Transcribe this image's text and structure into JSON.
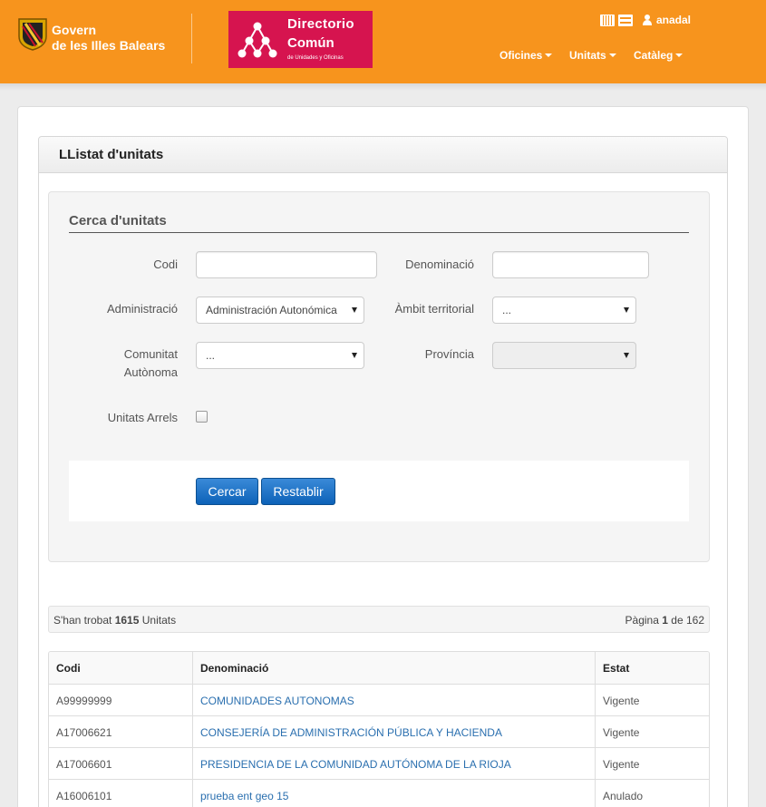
{
  "header": {
    "govern_line1": "Govern",
    "govern_line2": "de les Illes Balears",
    "directory_logo": {
      "line1": "Directorio",
      "line2": "Común",
      "line3": "de Unidades y Oficinas"
    },
    "username": "anadal",
    "nav": [
      "Oficines",
      "Unitats",
      "Catàleg"
    ],
    "colors": {
      "accent": "#f7941d",
      "brand_red": "#d6144f"
    }
  },
  "page": {
    "title": "LListat d'unitats"
  },
  "search": {
    "legend": "Cerca d'unitats",
    "labels": {
      "codi": "Codi",
      "denominacio": "Denominació",
      "administracio": "Administració",
      "ambit": "Àmbit territorial",
      "comunitat_line1": "Comunitat",
      "comunitat_line2": "Autònoma",
      "provincia": "Província",
      "arrels": "Unitats Arrels"
    },
    "values": {
      "codi": "",
      "denominacio": "",
      "administracio": "Administración Autonómica",
      "ambit": "...",
      "comunitat": "...",
      "provincia": ""
    },
    "buttons": {
      "cercar": "Cercar",
      "restablir": "Restablir"
    }
  },
  "results": {
    "found_prefix": "S'han trobat",
    "found_count": "1615",
    "found_suffix": "Unitats",
    "page_label": "Pàgina",
    "page_current": "1",
    "page_of": "de",
    "page_total": "162",
    "columns": [
      "Codi",
      "Denominació",
      "Estat"
    ],
    "rows": [
      {
        "codi": "A99999999",
        "denominacio": "COMUNIDADES AUTONOMAS",
        "estat": "Vigente"
      },
      {
        "codi": "A17006621",
        "denominacio": "CONSEJERÍA DE ADMINISTRACIÓN PÚBLICA Y HACIENDA",
        "estat": "Vigente"
      },
      {
        "codi": "A17006601",
        "denominacio": "PRESIDENCIA DE LA COMUNIDAD AUTÓNOMA DE LA RIOJA",
        "estat": "Vigente"
      },
      {
        "codi": "A16006101",
        "denominacio": "prueba ent geo 15",
        "estat": "Anulado"
      }
    ]
  }
}
